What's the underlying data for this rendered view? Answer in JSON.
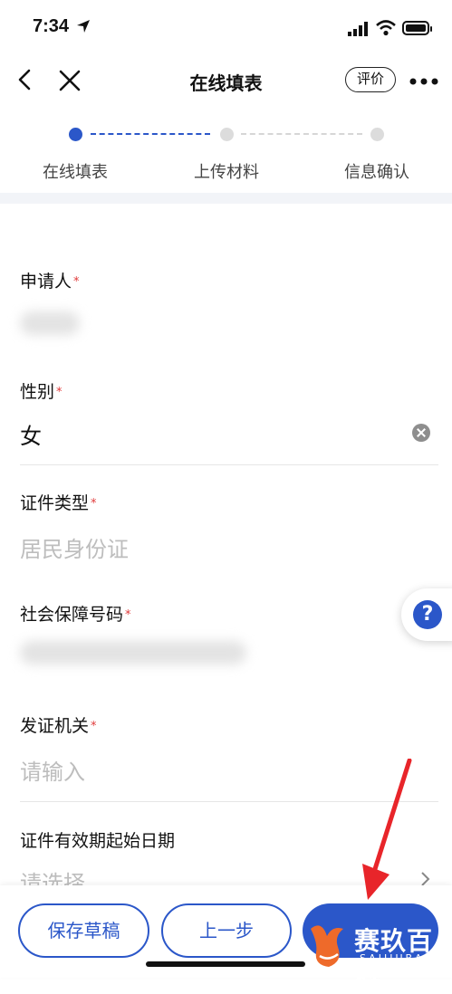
{
  "status_bar": {
    "time": "7:34"
  },
  "nav": {
    "title": "在线填表",
    "rate_label": "评价"
  },
  "steps": [
    {
      "label": "在线填表",
      "state": "active"
    },
    {
      "label": "上传材料",
      "state": "inactive"
    },
    {
      "label": "信息确认",
      "state": "inactive"
    }
  ],
  "form": {
    "applicant": {
      "label": "申请人",
      "required_mark": "*"
    },
    "gender": {
      "label": "性别",
      "required_mark": "*",
      "value": "女"
    },
    "id_type": {
      "label": "证件类型",
      "required_mark": "*",
      "value": "居民身份证"
    },
    "social_security": {
      "label": "社会保障号码",
      "required_mark": "*"
    },
    "issuing_authority": {
      "label": "发证机关",
      "required_mark": "*",
      "placeholder": "请输入"
    },
    "valid_start_date": {
      "label": "证件有效期起始日期",
      "placeholder": "请选择"
    }
  },
  "bottom": {
    "save_draft": "保存草稿",
    "previous": "上一步"
  },
  "watermark": {
    "title": "赛玖百科",
    "subtitle": "SAIJIUBAIKE"
  },
  "colors": {
    "primary": "#2b57c9",
    "required": "#e03a3a",
    "placeholder": "#bdbdbd",
    "arrow": "#e8252a"
  }
}
